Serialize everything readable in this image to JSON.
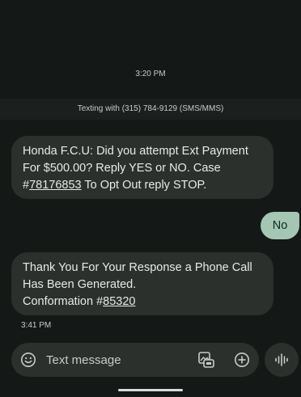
{
  "conversation": {
    "time_top": "3:20 PM",
    "banner": "Texting with (315) 784-9129 (SMS/MMS)",
    "messages": [
      {
        "direction": "incoming",
        "line1": "Honda F.C.U: Did you attempt Ext Payment",
        "line2": "For $500.00? Reply YES or NO. Case",
        "line3_pre": "#",
        "line3_link": "78176853",
        "line3_post": " To Opt Out reply STOP."
      },
      {
        "direction": "outgoing",
        "text": "No"
      },
      {
        "direction": "incoming",
        "line1": "Thank You For Your Response a Phone Call",
        "line2": "Has Been Generated.",
        "line3_pre": "Conformation #",
        "line3_link": "85320",
        "line3_post": ""
      }
    ],
    "time_bottom": "3:41 PM"
  },
  "composer": {
    "placeholder": "Text message",
    "icons": {
      "emoji": "emoji-icon",
      "gallery": "gallery-icon",
      "add": "add-icon",
      "voice": "voice-icon"
    }
  },
  "colors": {
    "background": "#141816",
    "incoming_bubble": "#2b302d",
    "outgoing_bubble": "#a4c6b2"
  }
}
